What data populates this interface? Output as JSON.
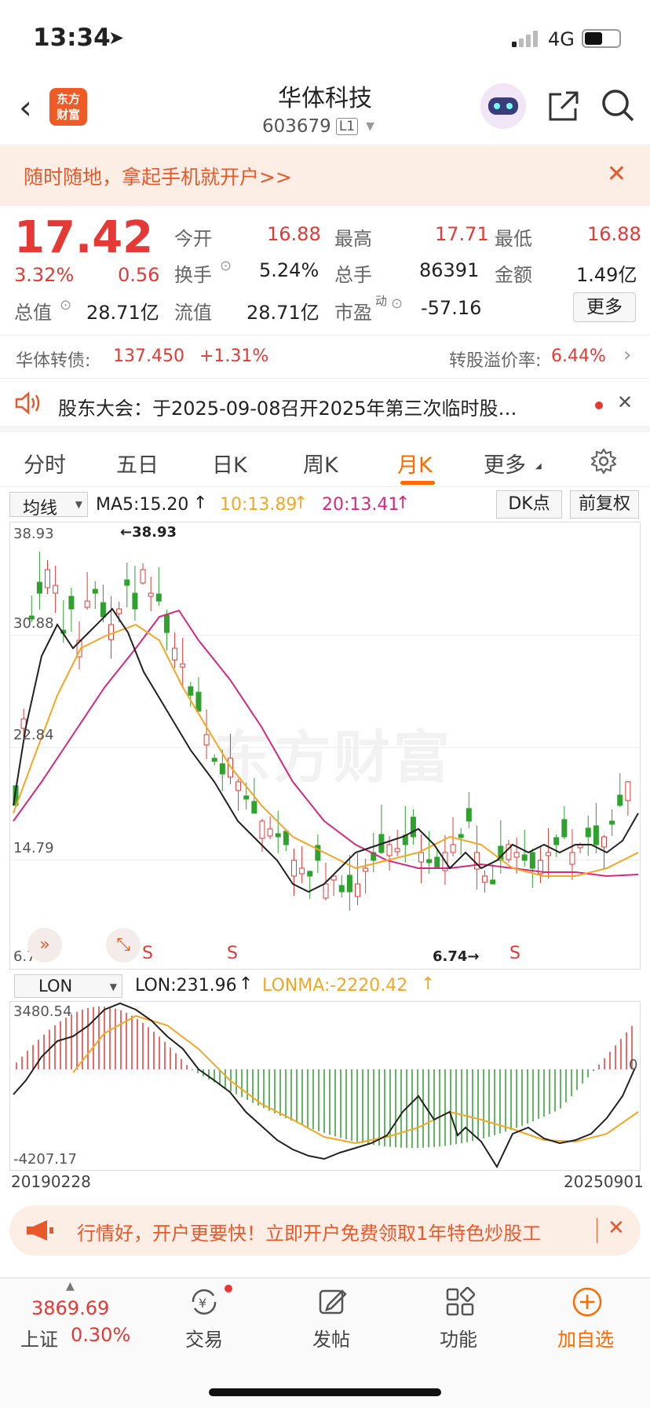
{
  "status": {
    "time": "13:34",
    "network": "4G"
  },
  "header": {
    "title": "华体科技",
    "code": "603679",
    "level": "L1",
    "logo_line1": "东方",
    "logo_line2": "财富"
  },
  "banner_top": {
    "text": "随时随地，拿起手机就开户>>"
  },
  "quote": {
    "price": "17.42",
    "pct": "3.32%",
    "chg": "0.56",
    "open_label": "今开",
    "open": "16.88",
    "high_label": "最高",
    "high": "17.71",
    "low_label": "最低",
    "low": "16.88",
    "turnover_label": "换手",
    "turnover": "5.24%",
    "vol_label": "总手",
    "vol": "86391",
    "amount_label": "金额",
    "amount": "1.49亿",
    "mktcap_label": "总值",
    "mktcap": "28.71亿",
    "float_label": "流值",
    "float": "28.71亿",
    "pe_label": "市盈",
    "pe_sup": "动",
    "pe": "-57.16",
    "more": "更多"
  },
  "bond": {
    "label": "华体转债:",
    "price": "137.450",
    "pct": "+1.31%",
    "premium_label": "转股溢价率:",
    "premium": "6.44%"
  },
  "notice": {
    "text": "股东大会：于2025-09-08召开2025年第三次临时股…"
  },
  "tabs": [
    "分时",
    "五日",
    "日K",
    "周K",
    "月K",
    "更多"
  ],
  "active_tab": 4,
  "indicator_bar": {
    "select": "均线",
    "ma5": "MA5:15.20",
    "ma10": "10:13.89",
    "ma20": "20:13.41",
    "dk": "DK点",
    "fq": "前复权"
  },
  "chart_axis": {
    "y_top": "38.93",
    "y_2": "30.88",
    "y_3": "22.84",
    "y_4": "14.79",
    "y_bottom": "6.74",
    "max_label": "←38.93",
    "min_label": "6.74→",
    "s_marks": [
      "S",
      "S",
      "S"
    ],
    "watermark": "东方财富"
  },
  "sub_bar": {
    "select": "LON",
    "lon": "LON:231.96",
    "lonma": "LONMA:-2220.42"
  },
  "sub_axis": {
    "top": "3480.54",
    "bottom": "-4207.17",
    "zero": "0"
  },
  "dates": {
    "start": "20190228",
    "end": "20250901"
  },
  "colors": {
    "up": "#e53935",
    "down": "#2ea12e",
    "ma5": "#222222",
    "ma10": "#f5a623",
    "ma20": "#d6297e",
    "accent": "#ff6a00"
  },
  "chart_data": {
    "type": "candlestick",
    "x_range": [
      "20190228",
      "20250901"
    ],
    "ylim": [
      6.74,
      38.93
    ],
    "max": 38.93,
    "min": 6.74,
    "last_close": 17.42
  },
  "ad": {
    "text": "行情好，开户更要快！立即开户免费领取1年特色炒股工"
  },
  "bottom": {
    "index_value": "3869.69",
    "index_name": "上证",
    "index_pct": "0.30%",
    "trade": "交易",
    "post": "发帖",
    "func": "功能",
    "add": "加自选"
  }
}
